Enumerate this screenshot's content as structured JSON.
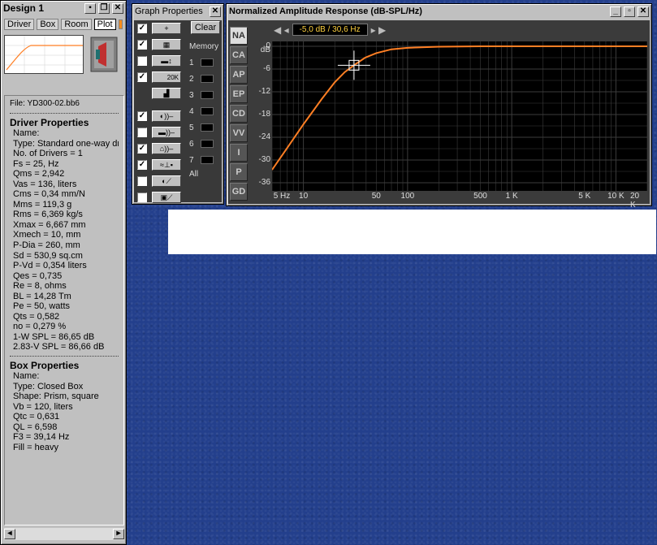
{
  "design": {
    "title": "Design 1",
    "tabs": [
      "Driver",
      "Box",
      "Room",
      "Plot"
    ],
    "active_tab": "Plot",
    "file": "File: YD300-02.bb6",
    "driver_title": "Driver Properties",
    "driver_lines": [
      "Name:",
      "Type: Standard one-way driver",
      "No. of Drivers = 1",
      "Fs = 25, Hz",
      "Qms = 2,942",
      "Vas = 136, liters",
      "Cms = 0,34 mm/N",
      "Mms = 119,3 g",
      "Rms = 6,369 kg/s",
      "Xmax = 6,667 mm",
      "Xmech = 10, mm",
      "P-Dia = 260, mm",
      "Sd = 530,9 sq.cm",
      "P-Vd = 0,354 liters",
      "Qes = 0,735",
      "Re = 8, ohms",
      "BL = 14,28 Tm",
      "Pe = 50, watts",
      "Qts = 0,582",
      "no = 0,279 %",
      "1-W SPL = 86,65 dB",
      "2.83-V SPL = 86,66 dB"
    ],
    "box_title": "Box Properties",
    "box_lines": [
      "Name:",
      "Type: Closed Box",
      "Shape: Prism, square",
      "Vb = 120, liters",
      "Qtc = 0,631",
      "QL = 6,598",
      "F3 = 39,14 Hz",
      "Fill = heavy"
    ]
  },
  "graph_props": {
    "title": "Graph Properties",
    "clear_label": "Clear",
    "memory_label": "Memory",
    "memory_slots": [
      "1",
      "2",
      "3",
      "4",
      "5",
      "6",
      "7"
    ],
    "all_label": "All",
    "hz_label": "20K",
    "checks": [
      true,
      true,
      false,
      true,
      false,
      true,
      false,
      true,
      true,
      false,
      false
    ]
  },
  "chart_window": {
    "title": "Normalized Amplitude Response (dB-SPL/Hz)",
    "cursor_readout": "-5,0 dB / 30,6 Hz",
    "side_tabs": [
      "NA",
      "CA",
      "AP",
      "EP",
      "CD",
      "VV",
      "I",
      "P",
      "GD"
    ],
    "active_side_tab": "NA"
  },
  "colors": {
    "curve": "#ff7f24",
    "plot_bg": "#000000",
    "grid": "#3c3c3c",
    "axis_text": "#dddddd"
  },
  "chart_data": {
    "type": "line",
    "title": "Normalized Amplitude Response (dB-SPL/Hz)",
    "x_scale": "log",
    "xlim": [
      5,
      20000
    ],
    "ylim": [
      -36,
      0
    ],
    "ylabel": "dB",
    "x_ticks": [
      "5 Hz",
      "10",
      "50",
      "100",
      "500",
      "1 K",
      "5 K",
      "10 K",
      "20 K"
    ],
    "x_tick_values": [
      5,
      10,
      50,
      100,
      500,
      1000,
      5000,
      10000,
      20000
    ],
    "y_ticks": [
      "0",
      "-6",
      "-12",
      "-18",
      "-24",
      "-30",
      "-36"
    ],
    "y_tick_values": [
      0,
      -6,
      -12,
      -18,
      -24,
      -30,
      -36
    ],
    "cursor": {
      "x": 30.6,
      "y": -5.0
    },
    "series": [
      {
        "x": [
          5,
          7,
          10,
          15,
          20,
          25,
          30.6,
          39.14,
          50,
          70,
          100,
          200,
          500,
          1000,
          5000,
          20000
        ],
        "y": [
          -32.6,
          -26.8,
          -20.6,
          -13.9,
          -9.5,
          -6.8,
          -5.0,
          -3.0,
          -1.8,
          -0.8,
          -0.4,
          -0.1,
          0,
          0,
          0,
          0
        ]
      }
    ]
  }
}
